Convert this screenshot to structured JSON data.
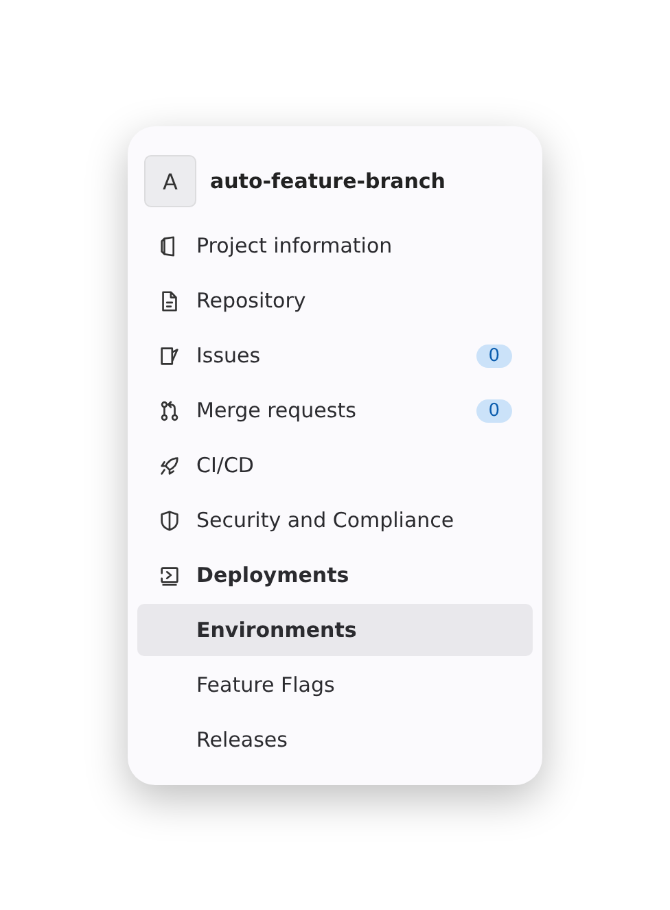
{
  "project": {
    "avatar": "A",
    "name": "auto-feature-branch"
  },
  "nav": [
    {
      "label": "Project information",
      "expanded": false,
      "selected": false
    },
    {
      "label": "Repository",
      "expanded": false,
      "selected": false
    },
    {
      "label": "Issues",
      "badge": "0",
      "expanded": false,
      "selected": false
    },
    {
      "label": "Merge requests",
      "badge": "0",
      "expanded": false,
      "selected": false
    },
    {
      "label": "CI/CD",
      "expanded": false,
      "selected": false
    },
    {
      "label": "Security and Compliance",
      "expanded": false,
      "selected": false
    },
    {
      "label": "Deployments",
      "expanded": true,
      "selected": false,
      "children": [
        {
          "label": "Environments",
          "selected": true
        },
        {
          "label": "Feature Flags",
          "selected": false
        },
        {
          "label": "Releases",
          "selected": false
        }
      ]
    }
  ]
}
